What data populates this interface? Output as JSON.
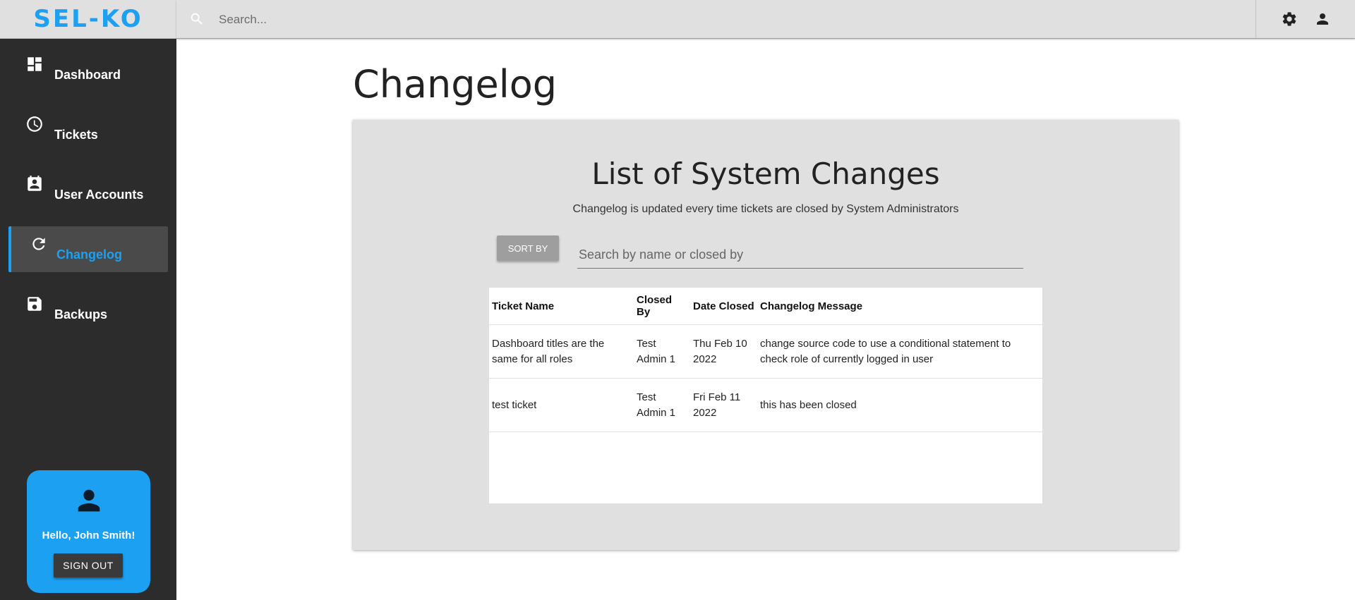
{
  "app": {
    "logo": "SEL-KO"
  },
  "colors": {
    "accent": "#1ca0f2",
    "sidebar_bg": "#2c2c2c",
    "topbar_bg": "#e0e0e0"
  },
  "topbar": {
    "search_placeholder": "Search...",
    "icons": [
      "search-icon",
      "gear-icon",
      "user-icon"
    ]
  },
  "sidebar": {
    "items": [
      {
        "label": "Dashboard",
        "icon": "dashboard-icon",
        "active": false
      },
      {
        "label": "Tickets",
        "icon": "clock-icon",
        "active": false
      },
      {
        "label": "User Accounts",
        "icon": "account-box-icon",
        "active": false
      },
      {
        "label": "Changelog",
        "icon": "refresh-icon",
        "active": true
      },
      {
        "label": "Backups",
        "icon": "save-icon",
        "active": false
      }
    ],
    "user_card": {
      "greeting": "Hello, John Smith!",
      "signout_label": "SIGN OUT"
    }
  },
  "main": {
    "page_title": "Changelog",
    "panel": {
      "title": "List of System Changes",
      "subtitle": "Changelog is updated every time tickets are closed by System Administrators",
      "sort_label": "SORT BY",
      "search_placeholder": "Search by name or closed by",
      "table": {
        "headers": [
          "Ticket Name",
          "Closed By",
          "Date Closed",
          "Changelog Message"
        ],
        "rows": [
          [
            "Dashboard titles are the same for all roles",
            "Test Admin 1",
            "Thu Feb 10 2022",
            "change source code to use a conditional statement to check role of currently logged in user"
          ],
          [
            "test ticket",
            "Test Admin 1",
            "Fri Feb 11 2022",
            "this has been closed"
          ]
        ]
      }
    }
  }
}
